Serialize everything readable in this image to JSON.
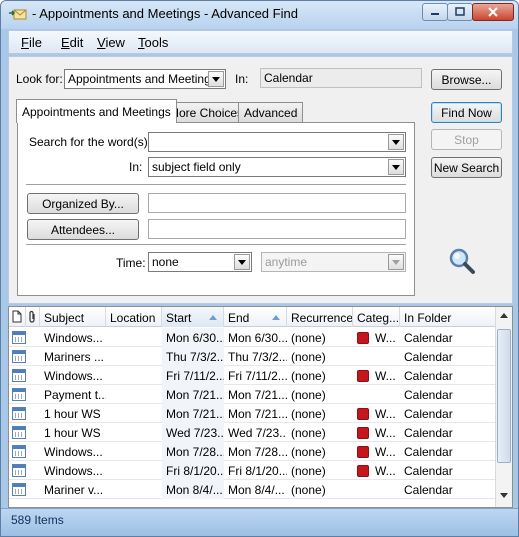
{
  "window": {
    "title": "- Appointments and Meetings - Advanced Find"
  },
  "menu": [
    {
      "pre": "",
      "key": "F",
      "post": "ile"
    },
    {
      "pre": "",
      "key": "E",
      "post": "dit"
    },
    {
      "pre": "",
      "key": "V",
      "post": "iew"
    },
    {
      "pre": "",
      "key": "T",
      "post": "ools"
    }
  ],
  "look_for": {
    "label": "Look for:",
    "value": "Appointments and Meetings"
  },
  "in": {
    "label": "In:",
    "value": "Calendar"
  },
  "buttons": {
    "browse": "Browse...",
    "find_now": "Find Now",
    "stop": "Stop",
    "new_search": "New Search"
  },
  "tabs": [
    "Appointments and Meetings",
    "More Choices",
    "Advanced"
  ],
  "form": {
    "search_words_label": "Search for the word(s):",
    "in_label": "In:",
    "in_value": "subject field only",
    "organized_by": "Organized By...",
    "attendees": "Attendees...",
    "time_label": "Time:",
    "time_value": "none",
    "time_range_value": "anytime"
  },
  "columns": [
    "Subject",
    "Location",
    "Start",
    "End",
    "Recurrence",
    "Categ...",
    "In Folder"
  ],
  "rows": [
    {
      "subject": "Windows...",
      "location": "",
      "start": "Mon 6/30...",
      "end": "Mon 6/30...",
      "recurrence": "(none)",
      "category": "W...",
      "has_cat": true,
      "folder": "Calendar"
    },
    {
      "subject": "Mariners ...",
      "location": "",
      "start": "Thu 7/3/2...",
      "end": "Thu 7/3/2...",
      "recurrence": "(none)",
      "category": "",
      "has_cat": false,
      "folder": "Calendar"
    },
    {
      "subject": "Windows...",
      "location": "",
      "start": "Fri 7/11/2...",
      "end": "Fri 7/11/2...",
      "recurrence": "(none)",
      "category": "W...",
      "has_cat": true,
      "folder": "Calendar"
    },
    {
      "subject": "Payment t...",
      "location": "",
      "start": "Mon 7/21...",
      "end": "Mon 7/21...",
      "recurrence": "(none)",
      "category": "",
      "has_cat": false,
      "folder": "Calendar"
    },
    {
      "subject": "1 hour WS",
      "location": "",
      "start": "Mon 7/21...",
      "end": "Mon 7/21...",
      "recurrence": "(none)",
      "category": "W...",
      "has_cat": true,
      "folder": "Calendar"
    },
    {
      "subject": "1 hour WS",
      "location": "",
      "start": "Wed 7/23...",
      "end": "Wed 7/23...",
      "recurrence": "(none)",
      "category": "W...",
      "has_cat": true,
      "folder": "Calendar"
    },
    {
      "subject": "Windows...",
      "location": "",
      "start": "Mon 7/28...",
      "end": "Mon 7/28...",
      "recurrence": "(none)",
      "category": "W...",
      "has_cat": true,
      "folder": "Calendar"
    },
    {
      "subject": "Windows...",
      "location": "",
      "start": "Fri 8/1/20...",
      "end": "Fri 8/1/20...",
      "recurrence": "(none)",
      "category": "W...",
      "has_cat": true,
      "folder": "Calendar"
    },
    {
      "subject": "Mariner v...",
      "location": "",
      "start": "Mon 8/4/...",
      "end": "Mon 8/4/...",
      "recurrence": "(none)",
      "category": "",
      "has_cat": false,
      "folder": "Calendar"
    }
  ],
  "status": "589 Items",
  "colors": {
    "category_red": "#c4161c",
    "accent": "#3c7fb1"
  }
}
